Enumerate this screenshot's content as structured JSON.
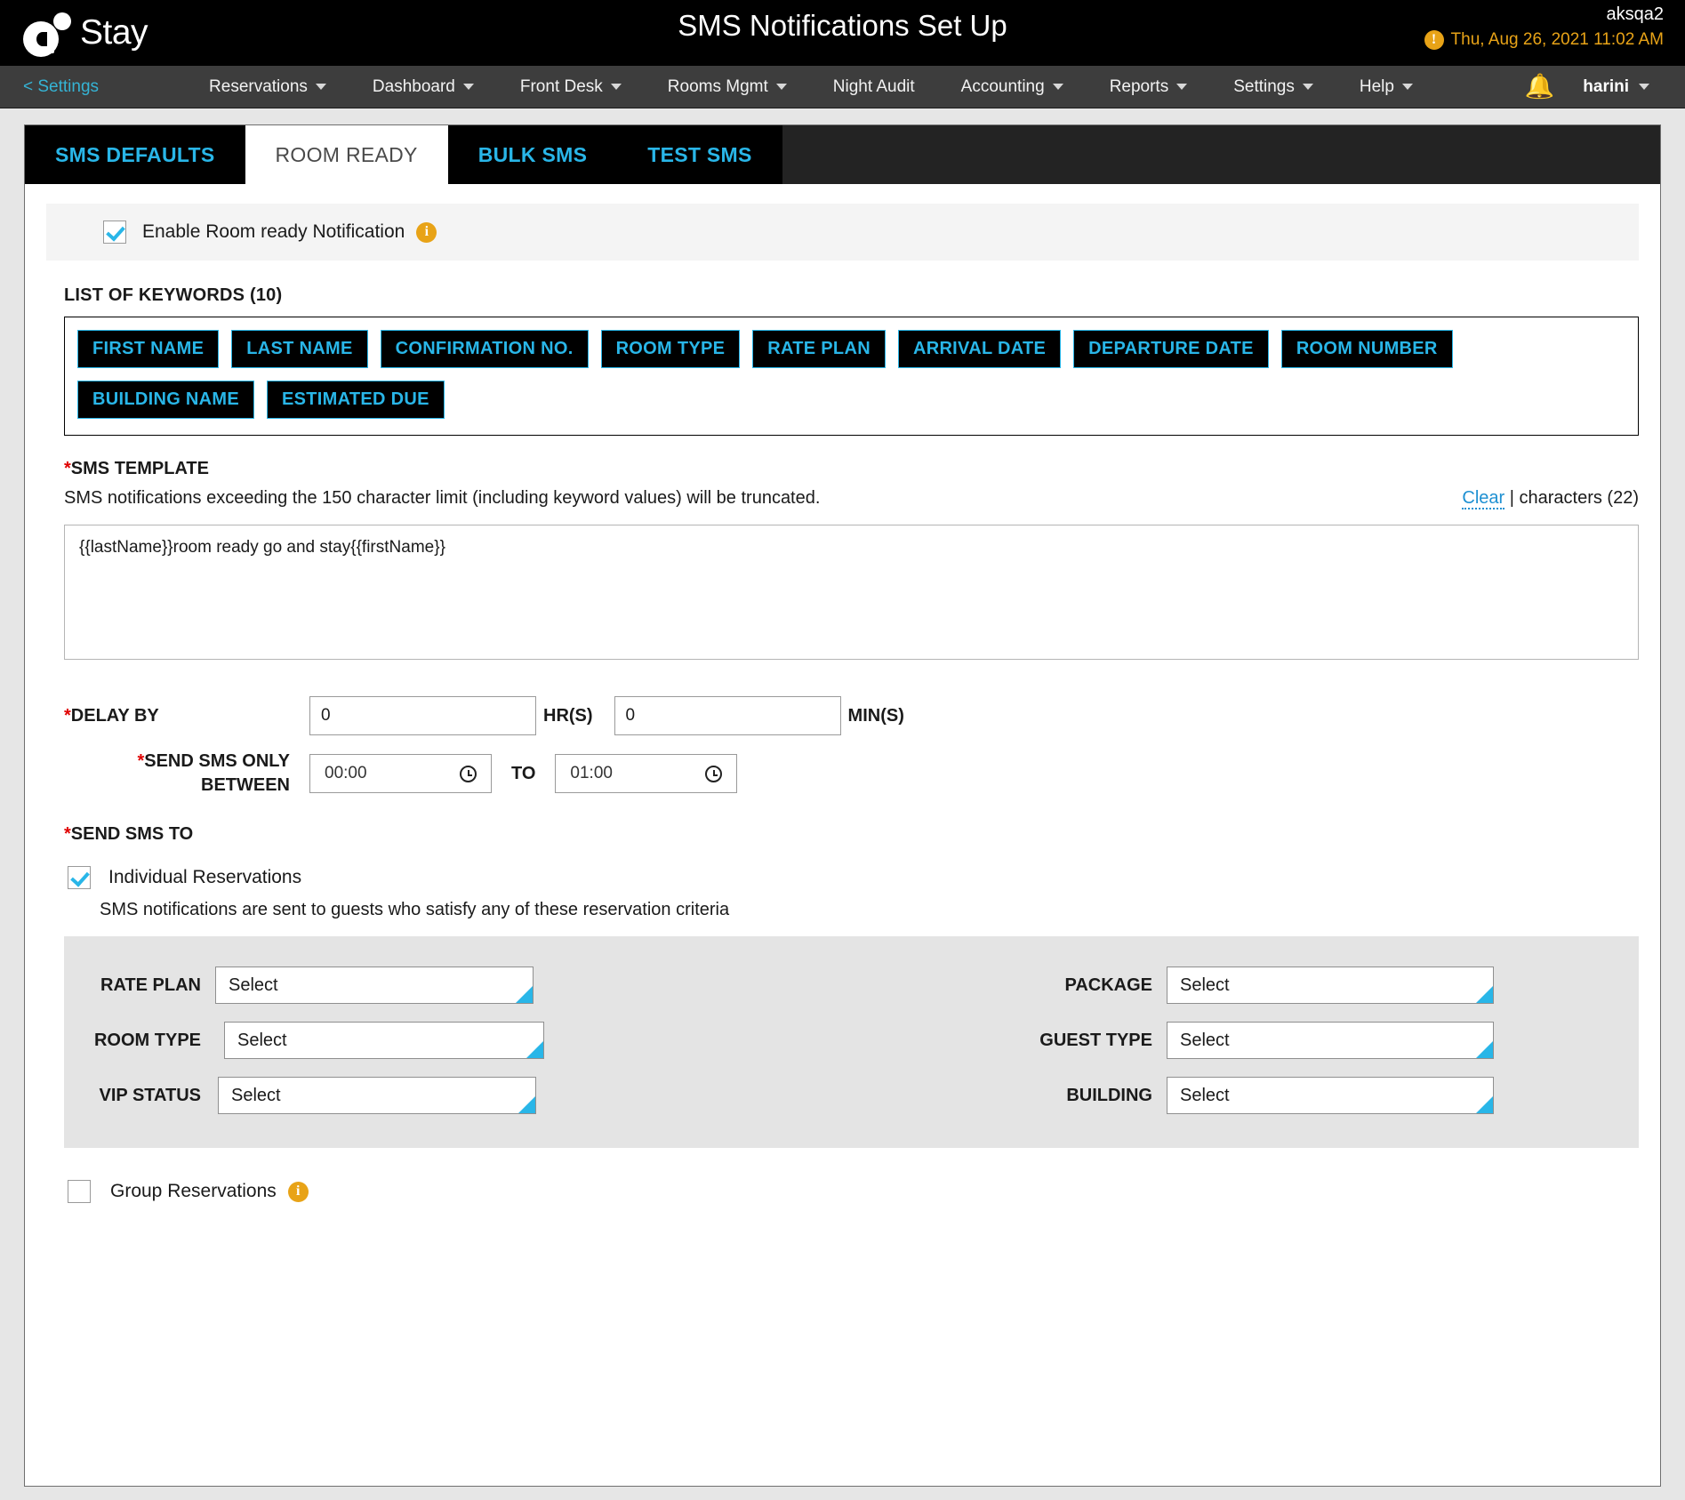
{
  "header": {
    "logo_text": "Stay",
    "page_title": "SMS Notifications Set Up",
    "account": "aksqa2",
    "datestamp": "Thu, Aug 26, 2021 11:02 AM",
    "warn_icon": "exclamation-icon"
  },
  "nav": {
    "back_label": "< Settings",
    "items": [
      {
        "label": "Reservations",
        "caret": true
      },
      {
        "label": "Dashboard",
        "caret": true
      },
      {
        "label": "Front Desk",
        "caret": true
      },
      {
        "label": "Rooms Mgmt",
        "caret": true
      },
      {
        "label": "Night Audit",
        "caret": false
      },
      {
        "label": "Accounting",
        "caret": true
      },
      {
        "label": "Reports",
        "caret": true
      },
      {
        "label": "Settings",
        "caret": true
      },
      {
        "label": "Help",
        "caret": true
      }
    ],
    "bell_icon": "bell-icon",
    "user": "harini"
  },
  "tabs": [
    {
      "label": "SMS DEFAULTS",
      "active": false
    },
    {
      "label": "ROOM READY",
      "active": true
    },
    {
      "label": "BULK SMS",
      "active": false
    },
    {
      "label": "TEST SMS",
      "active": false
    }
  ],
  "enable": {
    "label": "Enable Room ready Notification",
    "checked": true,
    "info_icon": "info-icon"
  },
  "keywords": {
    "title": "LIST OF KEYWORDS (10)",
    "count": 10,
    "items": [
      "FIRST NAME",
      "LAST NAME",
      "CONFIRMATION NO.",
      "ROOM TYPE",
      "RATE PLAN",
      "ARRIVAL DATE",
      "DEPARTURE DATE",
      "ROOM NUMBER",
      "BUILDING NAME",
      "ESTIMATED DUE"
    ]
  },
  "template": {
    "label": "SMS TEMPLATE",
    "required_mark": "*",
    "hint": "SMS notifications exceeding the 150 character limit (including keyword values) will be truncated.",
    "clear_label": "Clear",
    "counter": "| characters (22)",
    "value": "{{lastName}}room ready go and stay{{firstName}}"
  },
  "delay": {
    "label": "DELAY BY",
    "required_mark": "*",
    "hours_value": "0",
    "hours_unit": "HR(S)",
    "minutes_value": "0",
    "minutes_unit": "MIN(S)"
  },
  "between": {
    "label_line1": "SEND SMS ONLY",
    "label_line2": "BETWEEN",
    "required_mark": "*",
    "from_value": "00:00",
    "to_label": "TO",
    "to_value": "01:00",
    "clock_icon": "clock-icon"
  },
  "send_to": {
    "label": "SEND SMS TO",
    "required_mark": "*",
    "individual_label": "Individual Reservations",
    "individual_checked": true,
    "criteria_hint": "SMS notifications are sent to guests who satisfy any of these reservation criteria",
    "group_label": "Group Reservations",
    "group_checked": false,
    "group_info_icon": "info-icon"
  },
  "criteria": {
    "rate_plan_label": "RATE PLAN",
    "rate_plan_value": "Select",
    "package_label": "PACKAGE",
    "package_value": "Select",
    "room_type_label": "ROOM TYPE",
    "room_type_value": "Select",
    "guest_type_label": "GUEST TYPE",
    "guest_type_value": "Select",
    "vip_status_label": "VIP STATUS",
    "vip_status_value": "Select",
    "building_label": "BUILDING",
    "building_value": "Select"
  },
  "colors": {
    "accent_cyan": "#29b6e8",
    "link_blue": "#1e90d2",
    "warning_orange": "#e8a317",
    "required_red": "#e00000",
    "nav_bg": "#3d3d3d",
    "tab_bg": "#000000"
  }
}
